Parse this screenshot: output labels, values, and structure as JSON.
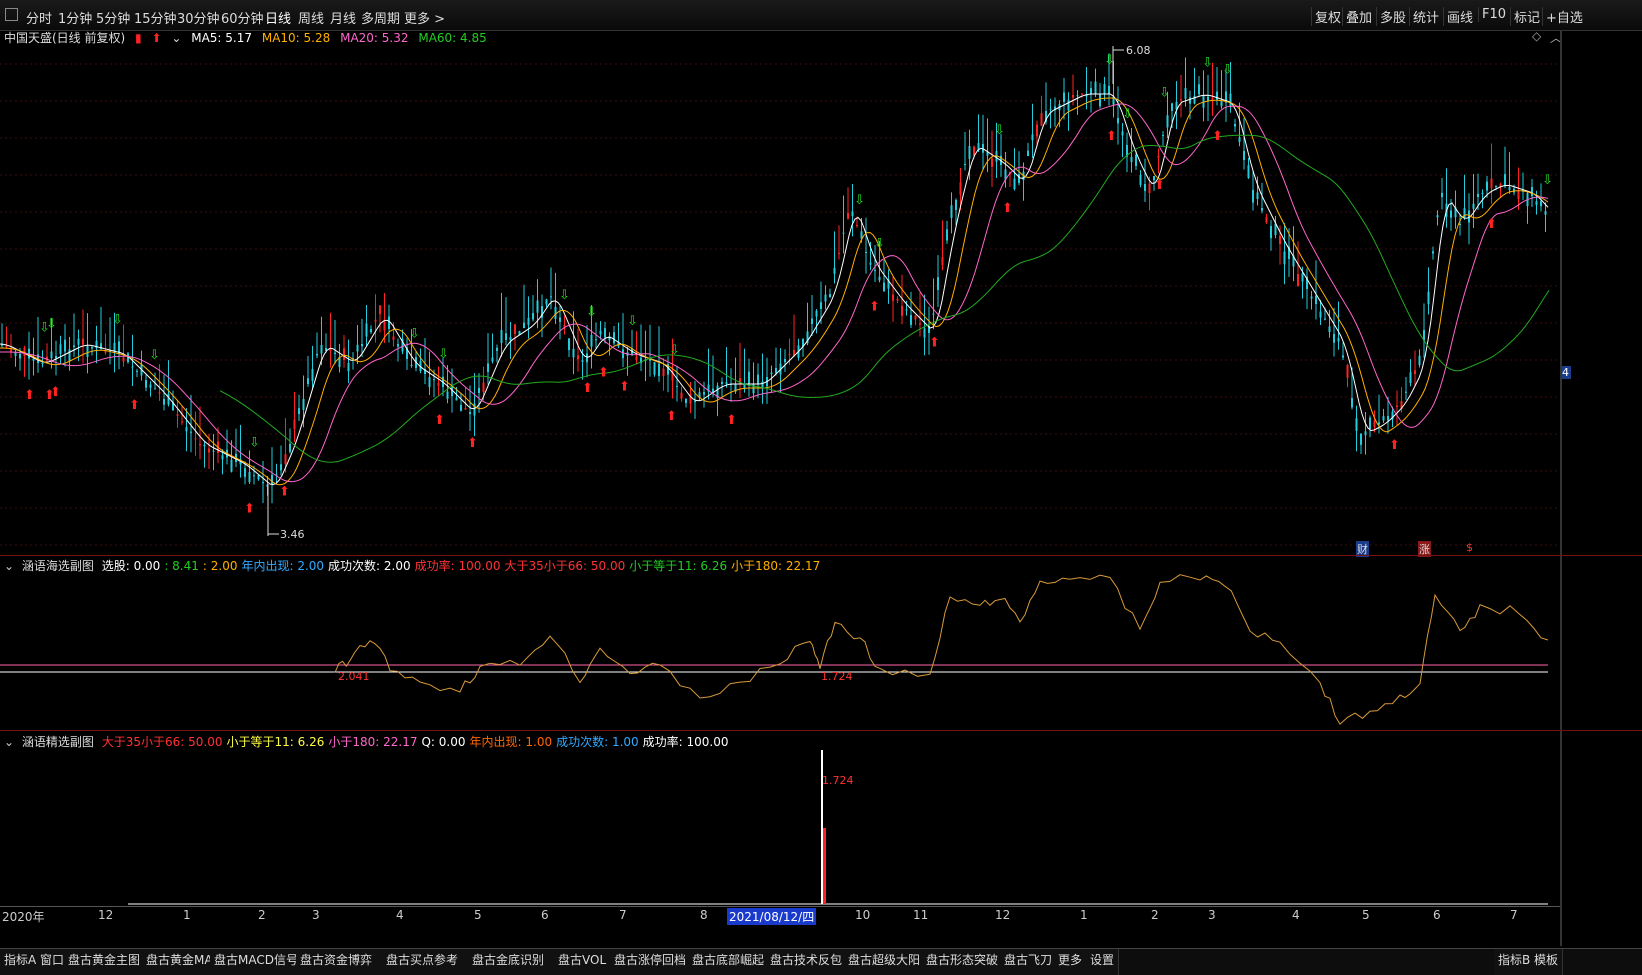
{
  "toolbar": {
    "periods": [
      "分时",
      "1分钟",
      "5分钟",
      "15分钟",
      "30分钟",
      "60分钟",
      "日线",
      "周线",
      "月线",
      "多周期",
      "更多 >"
    ],
    "active_period": "日线",
    "right_buttons": [
      "复权",
      "叠加",
      "多股",
      "统计",
      "画线",
      "F10",
      "标记",
      "+自选"
    ]
  },
  "main_legend": {
    "title": "中国天盛(日线 前复权)",
    "ma5": "MA5: 5.17",
    "ma10": "MA10: 5.28",
    "ma20": "MA20: 5.32",
    "ma60": "MA60: 4.85",
    "colors": {
      "ma5": "#ffffff",
      "ma10": "#ffb000",
      "ma20": "#ff66cc",
      "ma60": "#22cc22",
      "candle": "#22ccdd",
      "up": "#ff2222",
      "down": "#22dd22"
    }
  },
  "price_labels": {
    "high": "6.08",
    "low": "3.46"
  },
  "event_icons": [
    "财",
    "涨",
    "$"
  ],
  "right_edge_value": "4",
  "indicator1": {
    "name": "涵语海选副图",
    "items": [
      {
        "text": "选股: 0.00",
        "color": "#ffffff"
      },
      {
        "text": ": 8.41",
        "color": "#22cc22"
      },
      {
        "text": ": 2.00",
        "color": "#ffb000"
      },
      {
        "text": "年内出现: 2.00",
        "color": "#33aaff"
      },
      {
        "text": "成功次数: 2.00",
        "color": "#ffffff"
      },
      {
        "text": "成功率: 100.00",
        "color": "#ff3333"
      },
      {
        "text": "大于35小于66: 50.00",
        "color": "#ff3333"
      },
      {
        "text": "小于等于11: 6.26",
        "color": "#22cc22"
      },
      {
        "text": "小于180: 22.17",
        "color": "#ffb000"
      }
    ],
    "labels": [
      "2.041",
      "1.724"
    ]
  },
  "indicator2": {
    "name": "涵语精选副图",
    "items": [
      {
        "text": "大于35小于66: 50.00",
        "color": "#ff3333"
      },
      {
        "text": "小于等于11: 6.26",
        "color": "#ffff44"
      },
      {
        "text": "小于180: 22.17",
        "color": "#ff66cc"
      },
      {
        "text": "Q: 0.00",
        "color": "#ffffff"
      },
      {
        "text": "年内出现: 1.00",
        "color": "#ff6600"
      },
      {
        "text": "成功次数: 1.00",
        "color": "#33aaff"
      },
      {
        "text": "成功率: 100.00",
        "color": "#ffffff"
      }
    ],
    "label": "1.724"
  },
  "time_axis": {
    "labels": [
      "2020年",
      "12",
      "1",
      "2",
      "3",
      "4",
      "5",
      "6",
      "7",
      "8",
      "2021/08/12/四",
      "10",
      "11",
      "12",
      "1",
      "2",
      "3",
      "4",
      "5",
      "6",
      "7"
    ],
    "highlight": "2021/08/12/四"
  },
  "bottom_tabs": [
    "指标A 窗口",
    "盘古黄金主图",
    "盘古黄金MA",
    "盘古MACD信号",
    "盘古资金博弈",
    "盘古买点参考",
    "盘古金底识别",
    "盘古VOL",
    "盘古涨停回档",
    "盘古底部崛起",
    "盘古技术反包",
    "盘古超级大阳",
    "盘古形态突破",
    "盘古飞刀",
    "更多",
    "设置"
  ],
  "bottom_right": [
    "指标B",
    "模板"
  ]
}
